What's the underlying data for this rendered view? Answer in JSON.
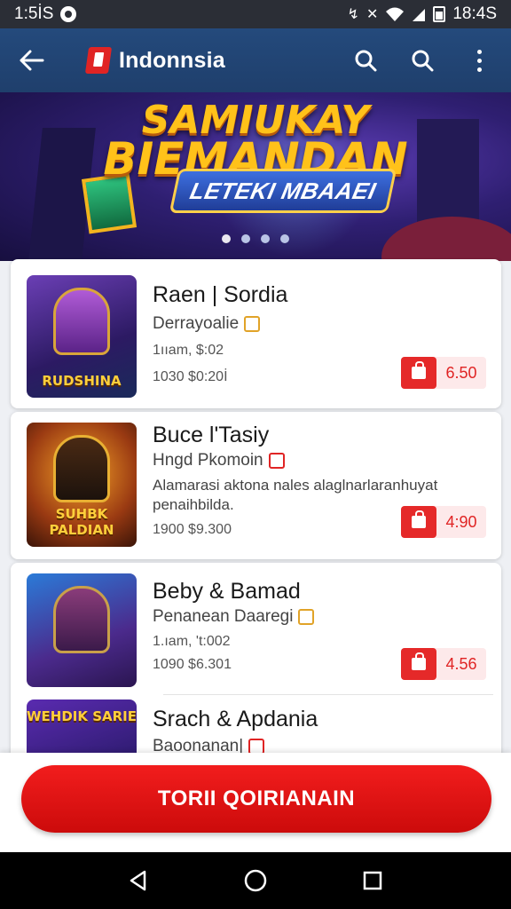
{
  "status_bar": {
    "time_left": "1:5İS",
    "time_right": "18:4S"
  },
  "app_bar": {
    "title": "Indonnsia"
  },
  "banner": {
    "line1": "SAMIUKAY",
    "line2": "BIEMANDAN",
    "subtitle": "LETEKI MBAAEI",
    "dots": 4,
    "active_dot": 0
  },
  "items": [
    {
      "title": "Raen | Sordia",
      "subtitle": "Derrayoalie",
      "meta1": "1ııam, $:02",
      "meta2": "1030 $0:20İ",
      "price": "6.50",
      "caption": "RUDSHINA"
    },
    {
      "title": "Buce l'Tasiy",
      "subtitle": "Hngd Pkomoin",
      "desc": "Alamarasi aktona nales alaglnarlaranhuyat penaihbilda.",
      "meta2": "1900 $9.300",
      "price": "4:90",
      "caption": "SUHBK PALDIAN"
    },
    {
      "title": "Beby & Bamad",
      "subtitle": "Penanean Daaregi",
      "meta1": "1.ıam, 't:002",
      "meta2": "1090 $6.301",
      "price": "4.56",
      "caption": ""
    },
    {
      "title": "Srach & Apdania",
      "subtitle": "Baoonanan|",
      "caption": "WEHDIK SARIE"
    }
  ],
  "cta": {
    "label": "TORII QOIRIANAIN"
  },
  "colors": {
    "accent": "#e02424",
    "app_bar": "#244a7c",
    "banner_bg": "#2f1f72"
  }
}
